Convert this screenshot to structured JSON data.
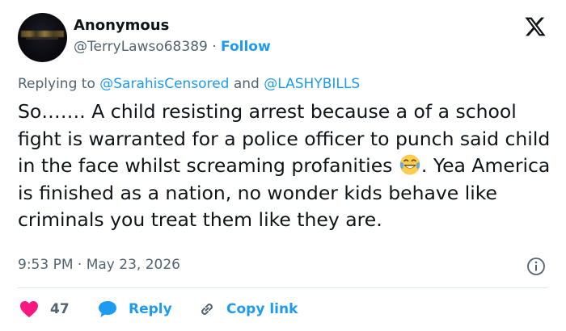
{
  "tweet": {
    "author": {
      "display_name": "Anonymous",
      "handle": "@TerryLawso68389",
      "separator": "·",
      "follow_label": "Follow"
    },
    "replying_to": {
      "prefix": "Replying to",
      "mention_1": "@SarahisCensored",
      "joiner": "and",
      "mention_2": "@LASHYBILLS"
    },
    "text_before_emoji": "So……. A child resisting arrest because a of a school fight is warranted for a police officer to punch said child in the face whilst screaming profanities",
    "text_after_emoji": ". Yea America is finished as a nation, no wonder kids behave like criminals you treat them like they are.",
    "emoji": "face-with-tears-of-joy",
    "timestamp": "9:53 PM · May 23, 2026",
    "actions": {
      "like_count": "47",
      "reply_label": "Reply",
      "copy_link_label": "Copy link"
    }
  },
  "icons": {
    "logo": "x-logo-icon",
    "info": "info-icon",
    "like": "heart-icon",
    "reply": "speech-bubble-icon",
    "copy": "link-icon"
  },
  "colors": {
    "accent": "#1d9bf0",
    "like": "#f91880",
    "secondary_text": "#536471",
    "primary_text": "#0f1419"
  }
}
